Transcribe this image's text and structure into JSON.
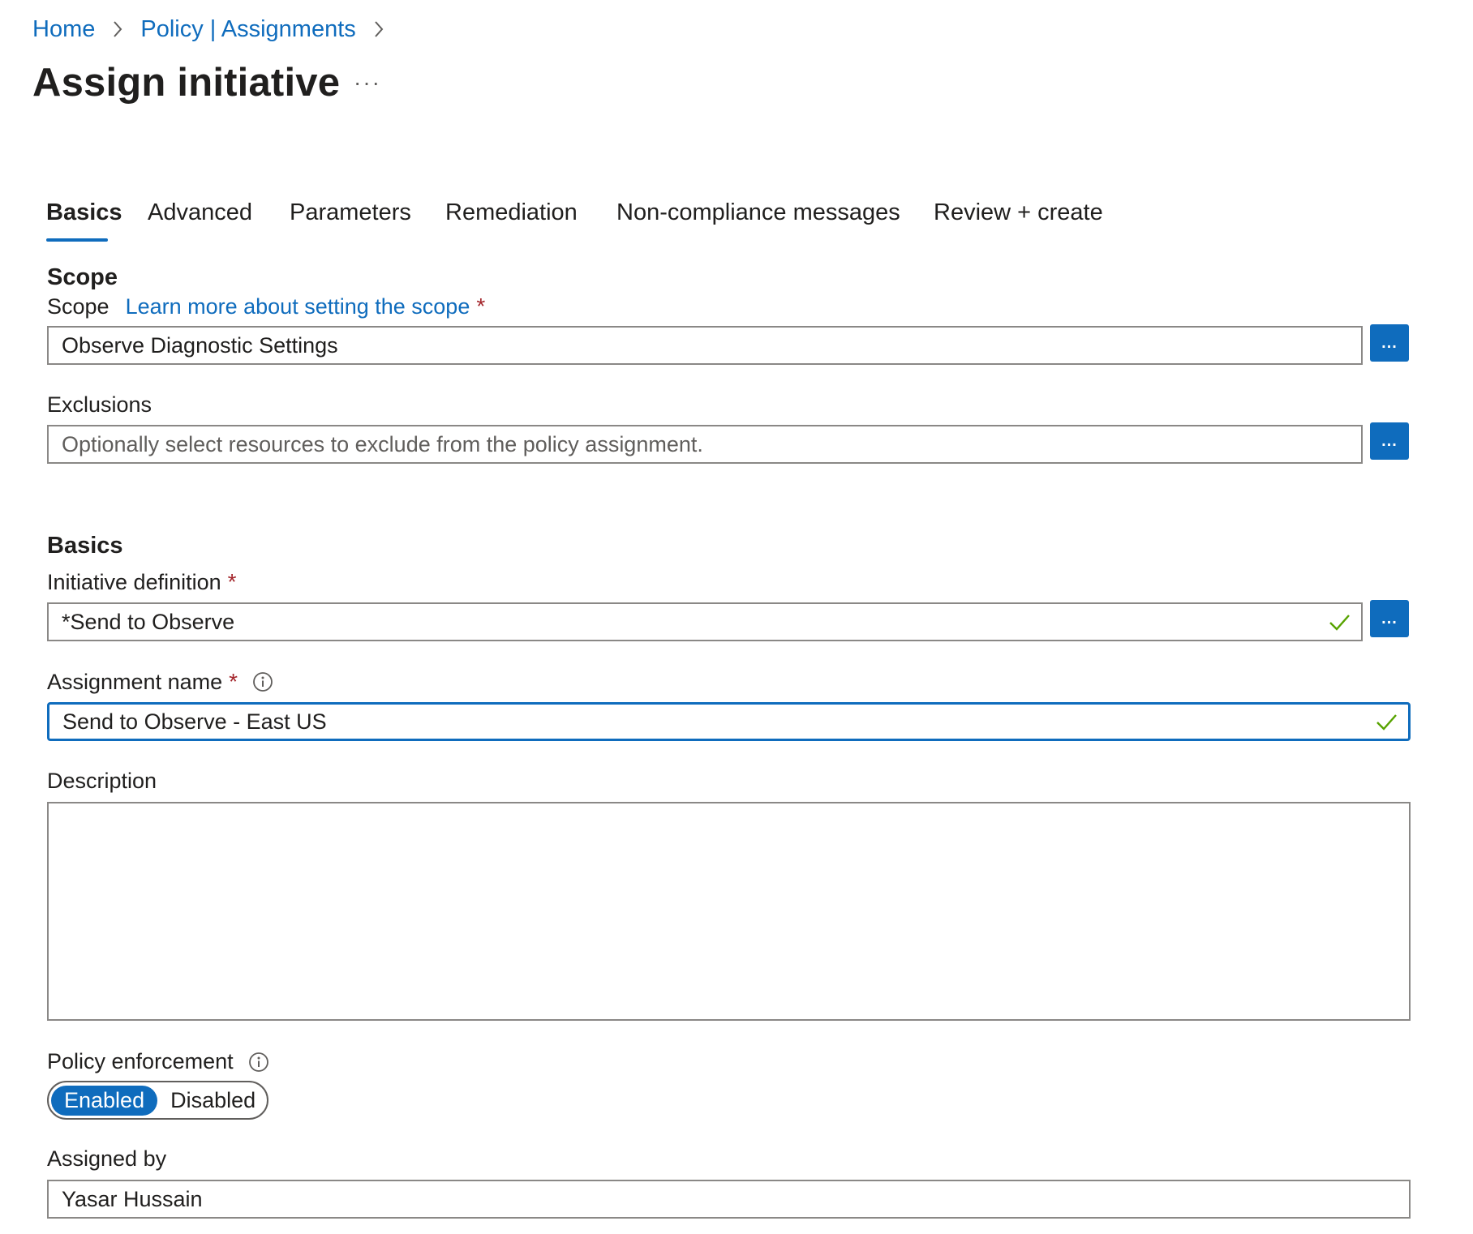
{
  "breadcrumb": {
    "items": [
      "Home",
      "Policy | Assignments"
    ]
  },
  "header": {
    "title": "Assign initiative",
    "more_label": "···"
  },
  "tabs": [
    {
      "label": "Basics",
      "active": true
    },
    {
      "label": "Advanced"
    },
    {
      "label": "Parameters"
    },
    {
      "label": "Remediation"
    },
    {
      "label": "Non-compliance messages"
    },
    {
      "label": "Review + create"
    }
  ],
  "scope_section": {
    "heading": "Scope",
    "scope_label": "Scope",
    "scope_link": "Learn more about setting the scope",
    "required_mark": "*",
    "scope_value": "Observe Diagnostic Settings",
    "exclusions_label": "Exclusions",
    "exclusions_placeholder": "Optionally select resources to exclude from the policy assignment.",
    "browse_label": "..."
  },
  "basics_section": {
    "heading": "Basics",
    "initiative_label": "Initiative definition",
    "initiative_value": "*Send to Observe",
    "assignment_name_label": "Assignment name",
    "assignment_name_value": "Send to Observe - East US",
    "description_label": "Description",
    "description_value": "",
    "enforcement_label": "Policy enforcement",
    "enforcement_options": [
      "Enabled",
      "Disabled"
    ],
    "enforcement_selected": "Enabled",
    "assigned_by_label": "Assigned by",
    "assigned_by_value": "Yasar Hussain"
  },
  "colors": {
    "accent": "#0f6cbd",
    "required": "#a4262c",
    "valid_check": "#57a300",
    "border": "#8a8886"
  },
  "icons": [
    "chevron-right-icon",
    "checkmark-icon",
    "info-icon",
    "more-icon"
  ]
}
